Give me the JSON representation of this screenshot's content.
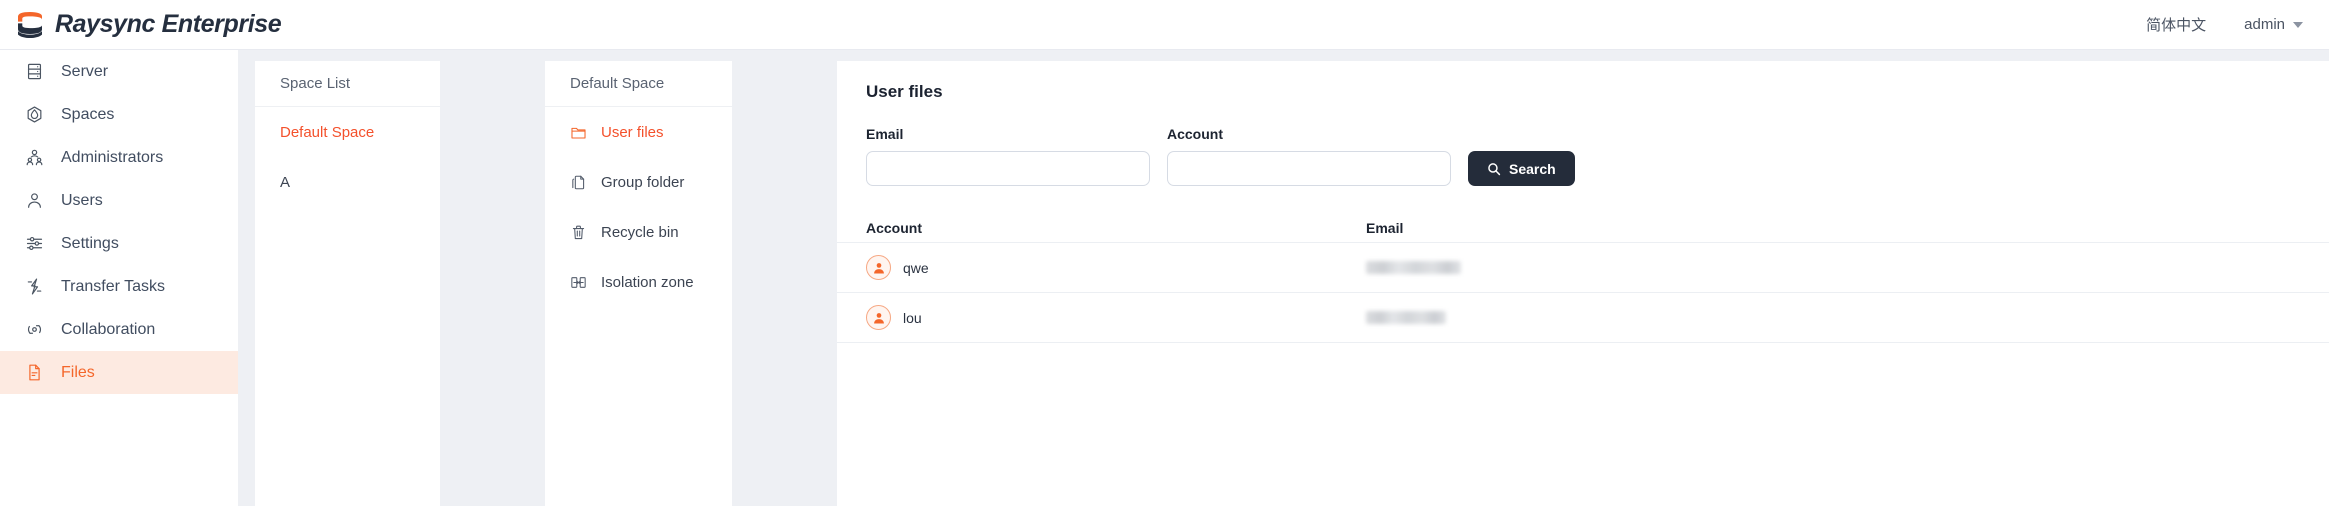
{
  "header": {
    "brand_name": "Raysync Enterprise",
    "logo_icon": "raysync-s-logo",
    "language_label": "简体中文",
    "user_label": "admin",
    "caret_icon": "chevron-down-icon"
  },
  "sidebar": {
    "items": [
      {
        "label": "Server",
        "icon": "server-icon",
        "active": false
      },
      {
        "label": "Spaces",
        "icon": "spaces-icon",
        "active": false
      },
      {
        "label": "Administrators",
        "icon": "administrators-icon",
        "active": false
      },
      {
        "label": "Users",
        "icon": "user-icon",
        "active": false
      },
      {
        "label": "Settings",
        "icon": "sliders-icon",
        "active": false
      },
      {
        "label": "Transfer Tasks",
        "icon": "transfer-icon",
        "active": false
      },
      {
        "label": "Collaboration",
        "icon": "collaboration-icon",
        "active": false
      },
      {
        "label": "Files",
        "icon": "file-icon",
        "active": true
      }
    ]
  },
  "space_list_panel": {
    "title": "Space List",
    "items": [
      {
        "label": "Default Space",
        "selected": true
      },
      {
        "label": "A",
        "selected": false
      }
    ]
  },
  "space_detail_panel": {
    "title": "Default Space",
    "items": [
      {
        "label": "User files",
        "icon": "folder-icon",
        "selected": true
      },
      {
        "label": "Group folder",
        "icon": "group-folder-icon",
        "selected": false
      },
      {
        "label": "Recycle bin",
        "icon": "trash-icon",
        "selected": false
      },
      {
        "label": "Isolation zone",
        "icon": "isolation-icon",
        "selected": false
      }
    ]
  },
  "content": {
    "title": "User files",
    "filters": {
      "email": {
        "label": "Email",
        "value": "",
        "placeholder": ""
      },
      "account": {
        "label": "Account",
        "value": "",
        "placeholder": ""
      },
      "search_button": {
        "label": "Search",
        "icon": "search-icon"
      }
    },
    "table": {
      "columns": [
        {
          "key": "account",
          "label": "Account"
        },
        {
          "key": "email",
          "label": "Email"
        }
      ],
      "rows": [
        {
          "account": "qwe",
          "avatar_icon": "user-avatar-icon",
          "email": "",
          "email_redacted": true,
          "email_redacted_width": 95
        },
        {
          "account": "lou",
          "avatar_icon": "user-avatar-icon",
          "email": "",
          "email_redacted": true,
          "email_redacted_width": 80
        }
      ]
    }
  },
  "colors": {
    "brand_orange": "#f4662a",
    "brand_navy": "#252f3f",
    "active_nav_bg": "#fdeae1",
    "workspace_bg": "#eef0f4",
    "button_dark": "#242c3a"
  }
}
